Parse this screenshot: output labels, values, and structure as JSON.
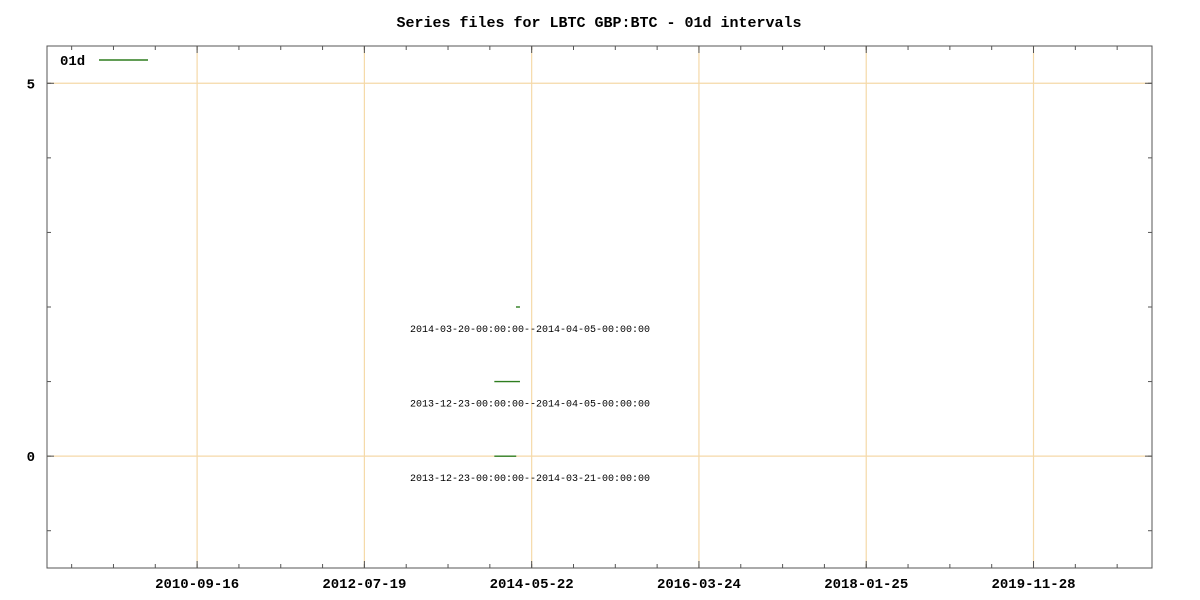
{
  "chart_data": {
    "type": "line",
    "title": "Series files for LBTC GBP:BTC - 01d intervals",
    "xlabel": "",
    "ylabel": "",
    "x_axis": "date",
    "xlim": [
      "2009-01-21",
      "2021-03-18"
    ],
    "ylim": [
      -1.5,
      5.5
    ],
    "grid": true,
    "grid_color": "#f5d9a8",
    "legend_position": "top-left",
    "x_ticks": [
      "2010-09-16",
      "2012-07-19",
      "2014-05-22",
      "2016-03-24",
      "2018-01-25",
      "2019-11-28"
    ],
    "y_ticks": [
      0,
      5
    ],
    "series": [
      {
        "name": "01d",
        "color": "#2e7d1f",
        "segments": [
          {
            "start": "2013-12-23",
            "end": "2014-03-21",
            "y": 0,
            "label": "2013-12-23-00:00:00--2014-03-21-00:00:00"
          },
          {
            "start": "2013-12-23",
            "end": "2014-04-05",
            "y": 1,
            "label": "2013-12-23-00:00:00--2014-04-05-00:00:00"
          },
          {
            "start": "2014-03-20",
            "end": "2014-04-05",
            "y": 2,
            "label": "2014-03-20-00:00:00--2014-04-05-00:00:00"
          }
        ]
      }
    ]
  }
}
